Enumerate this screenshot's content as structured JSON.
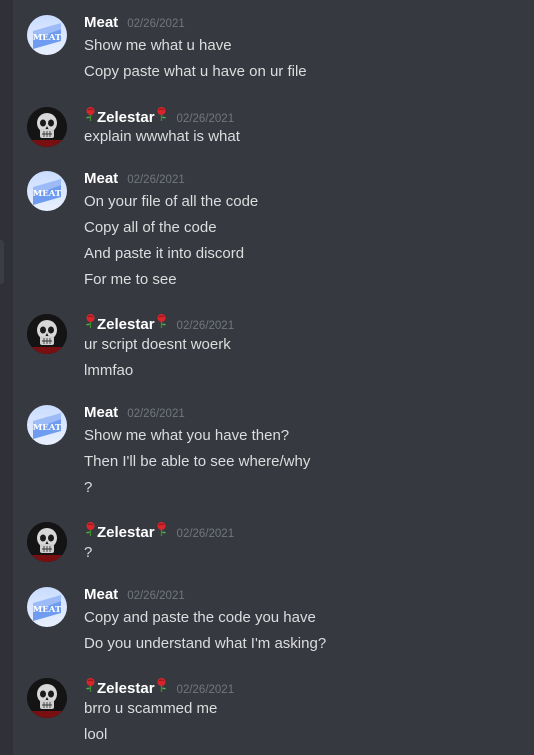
{
  "users": {
    "meat": {
      "name": "Meat",
      "avatar_text": "MEAT"
    },
    "zelestar": {
      "name": "Zelestar"
    }
  },
  "colors": {
    "background": "#36393f",
    "message_text": "#dcddde",
    "username": "#ffffff",
    "timestamp": "#72767d"
  },
  "groups": [
    {
      "author": "Meat",
      "timestamp": "02/26/2021",
      "messages": [
        "Show me what u have",
        "Copy paste what u have on ur file"
      ]
    },
    {
      "author": "Zelestar",
      "timestamp": "02/26/2021",
      "messages": [
        "explain wwwhat is what"
      ]
    },
    {
      "author": "Meat",
      "timestamp": "02/26/2021",
      "messages": [
        "On your file of all the code",
        "Copy all of the code",
        "And paste it into discord",
        "For me to see"
      ]
    },
    {
      "author": "Zelestar",
      "timestamp": "02/26/2021",
      "messages": [
        "ur script doesnt woerk",
        "lmmfao"
      ]
    },
    {
      "author": "Meat",
      "timestamp": "02/26/2021",
      "messages": [
        "Show me what you have then?",
        "Then I'll be able to see where/why",
        "?"
      ]
    },
    {
      "author": "Zelestar",
      "timestamp": "02/26/2021",
      "messages": [
        "?"
      ]
    },
    {
      "author": "Meat",
      "timestamp": "02/26/2021",
      "messages": [
        "Copy and paste the code you have",
        "Do you understand what I'm asking?"
      ]
    },
    {
      "author": "Zelestar",
      "timestamp": "02/26/2021",
      "messages": [
        "brro u scammed me",
        "lool"
      ]
    }
  ]
}
